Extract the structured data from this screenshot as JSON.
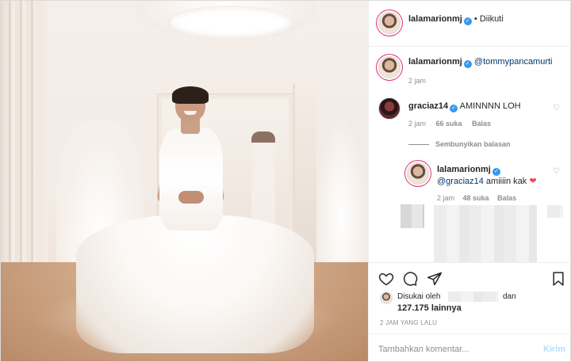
{
  "header": {
    "username": "lalamarionmj",
    "follow_status": "• Diikuti"
  },
  "caption": {
    "username": "lalamarionmj",
    "mention": "@tommypancamurti",
    "time": "2 jam"
  },
  "comments": [
    {
      "username": "graciaz14",
      "text": "AMINNNN LOH",
      "time": "2 jam",
      "likes": "66 suka",
      "reply_label": "Balas"
    }
  ],
  "hide_replies_label": "Sembunyikan balasan",
  "reply": {
    "username": "lalamarionmj",
    "mention": "@graciaz14",
    "text": " amiiiin kak",
    "emoji": "❤",
    "time": "2 jam",
    "likes": "48 suka",
    "reply_label": "Balas"
  },
  "likes": {
    "prefix": "Disukai oleh",
    "suffix": "dan",
    "count_text": "127.175 lainnya"
  },
  "post_time": "2 JAM YANG LALU",
  "comment_input": {
    "placeholder": "Tambahkan komentar...",
    "send_label": "Kirim"
  },
  "colors": {
    "verified": "#3897f0",
    "heart_red": "#ed4956",
    "send_disabled": "#b2dffc",
    "muted": "#8e8e8e"
  }
}
